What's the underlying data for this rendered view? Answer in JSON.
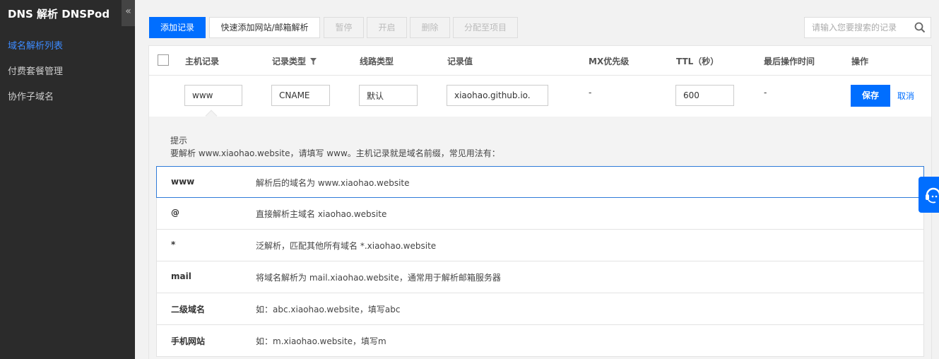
{
  "sidebar": {
    "title": "DNS 解析 DNSPod",
    "collapse_glyph": "«",
    "items": [
      {
        "label": "域名解析列表"
      },
      {
        "label": "付费套餐管理"
      },
      {
        "label": "协作子域名"
      }
    ]
  },
  "toolbar": {
    "add_record": "添加记录",
    "quick_add": "快速添加网站/邮箱解析",
    "pause": "暂停",
    "enable": "开启",
    "delete": "删除",
    "assign_project": "分配至项目",
    "search_placeholder": "请输入您要搜索的记录"
  },
  "table": {
    "headers": {
      "host": "主机记录",
      "type": "记录类型",
      "line": "线路类型",
      "value": "记录值",
      "mx": "MX优先级",
      "ttl": "TTL（秒）",
      "last_op": "最后操作时间",
      "action": "操作"
    },
    "edit_row": {
      "host": "www",
      "type": "CNAME",
      "line": "默认",
      "value": "xiaohao.github.io.",
      "mx": "-",
      "ttl": "600",
      "last_op": "-",
      "save": "保存",
      "cancel": "取消"
    }
  },
  "hint": {
    "title": "提示",
    "desc": "要解析 www.xiaohao.website，请填写 www。主机记录就是域名前缀，常见用法有：",
    "rows": [
      {
        "k": "www",
        "v": "解析后的域名为 www.xiaohao.website"
      },
      {
        "k": "@",
        "v": "直接解析主域名 xiaohao.website"
      },
      {
        "k": "*",
        "v": "泛解析，匹配其他所有域名 *.xiaohao.website"
      },
      {
        "k": "mail",
        "v": "将域名解析为 mail.xiaohao.website，通常用于解析邮箱服务器"
      },
      {
        "k": "二级域名",
        "v": "如：abc.xiaohao.website，填写abc"
      },
      {
        "k": "手机网站",
        "v": "如：m.xiaohao.website，填写m"
      }
    ]
  },
  "colors": {
    "primary": "#006eff",
    "sidebar_bg": "#2b2b2b",
    "sidebar_active": "#3d8bff"
  },
  "icons": {
    "search": "search-icon",
    "filter": "filter-icon",
    "support": "headset-icon"
  }
}
